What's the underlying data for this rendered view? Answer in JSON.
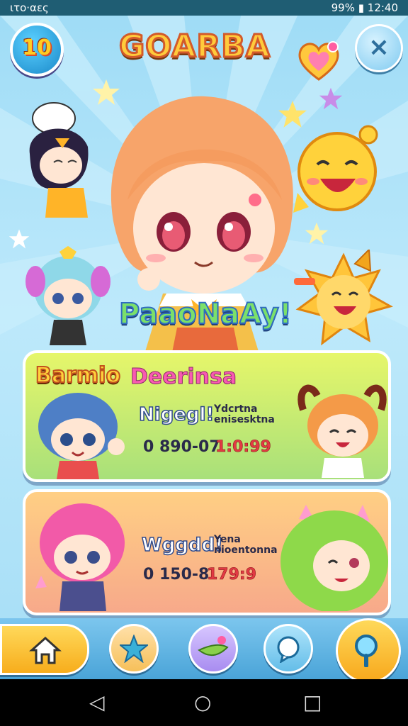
{
  "status_bar": {
    "left": "ιτο·αες",
    "right": "99% ▮ 12:40"
  },
  "header": {
    "badge_text": "10",
    "app_title": "GOARBA"
  },
  "banner": {
    "subtitle": "PaaoNaAy!"
  },
  "cards": [
    {
      "title": "Barmio",
      "subtitle": "Deerinsa",
      "label": "Nigegl!",
      "small_text": "Ydcrtna\nenisesktna",
      "value": "0 890-07",
      "value_red": "1:0:99"
    },
    {
      "title": "",
      "subtitle": "",
      "label": "Wggdd!",
      "small_text": "Yena\nnioentonna",
      "value": "0 150-8",
      "value_red": "179:9"
    }
  ],
  "nav": {
    "items": [
      "home-icon",
      "star-icon",
      "fish-icon",
      "chat-icon",
      "search-icon"
    ]
  },
  "colors": {
    "title_fill": "#ffcb3c",
    "title_stroke": "#d35a2a",
    "card1": "#d8f173",
    "card2": "#ffbf84",
    "accent": "#f7ad1c"
  }
}
